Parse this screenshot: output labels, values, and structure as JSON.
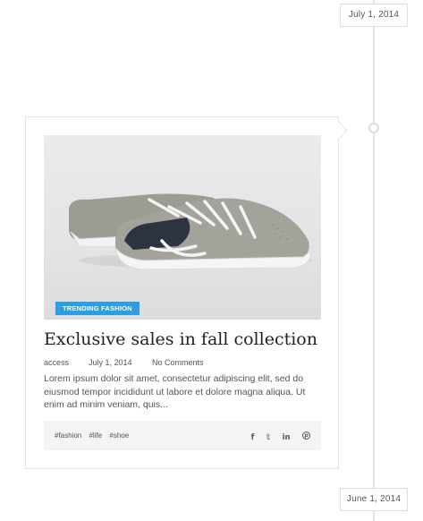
{
  "timeline": {
    "top_date": "July 1, 2014",
    "bottom_date": "June 1, 2014"
  },
  "post": {
    "image_alt": "grey canvas sneaker on white background",
    "category": "TRENDING FASHION",
    "title": "Exclusive sales in fall collection",
    "meta": {
      "author": "access",
      "date": "July 1, 2014",
      "comments": "No Comments"
    },
    "excerpt": "Lorem ipsum dolor sit amet, consectetur adipiscing elit, sed do eiusmod tempor incididunt ut labore et dolore magna aliqua. Ut enim ad minim veniam, quis...",
    "tags": [
      "#fashion",
      "#life",
      "#shoe"
    ],
    "share_icons": [
      {
        "name": "facebook-icon",
        "glyph": "f"
      },
      {
        "name": "twitter-icon",
        "glyph": "𝕥"
      },
      {
        "name": "linkedin-icon",
        "glyph": "in"
      },
      {
        "name": "pinterest-icon",
        "glyph": "p"
      }
    ]
  },
  "colors": {
    "accent": "#2f9de3",
    "timeline": "#e4e4e4",
    "footer_bg": "#f4f4f4"
  }
}
